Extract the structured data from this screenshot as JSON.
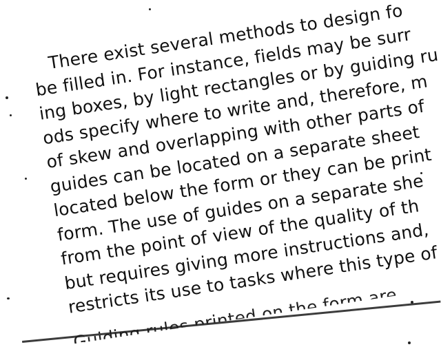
{
  "document": {
    "lines": [
      "There exist several methods to design fo",
      "be filled in. For instance, fields may be surr",
      "ing boxes, by light rectangles or by guiding ru",
      "ods specify where to write and, therefore, m",
      "of skew and overlapping with other parts of",
      "guides can be located on a separate sheet",
      "located below the form or they can be print",
      "form. The use of guides on a separate she",
      "from the point of view of the quality of th",
      "but requires giving more instructions and,",
      "restricts its use to tasks where this type of a"
    ],
    "cut_line": "Guiding rules printed on the form are"
  }
}
